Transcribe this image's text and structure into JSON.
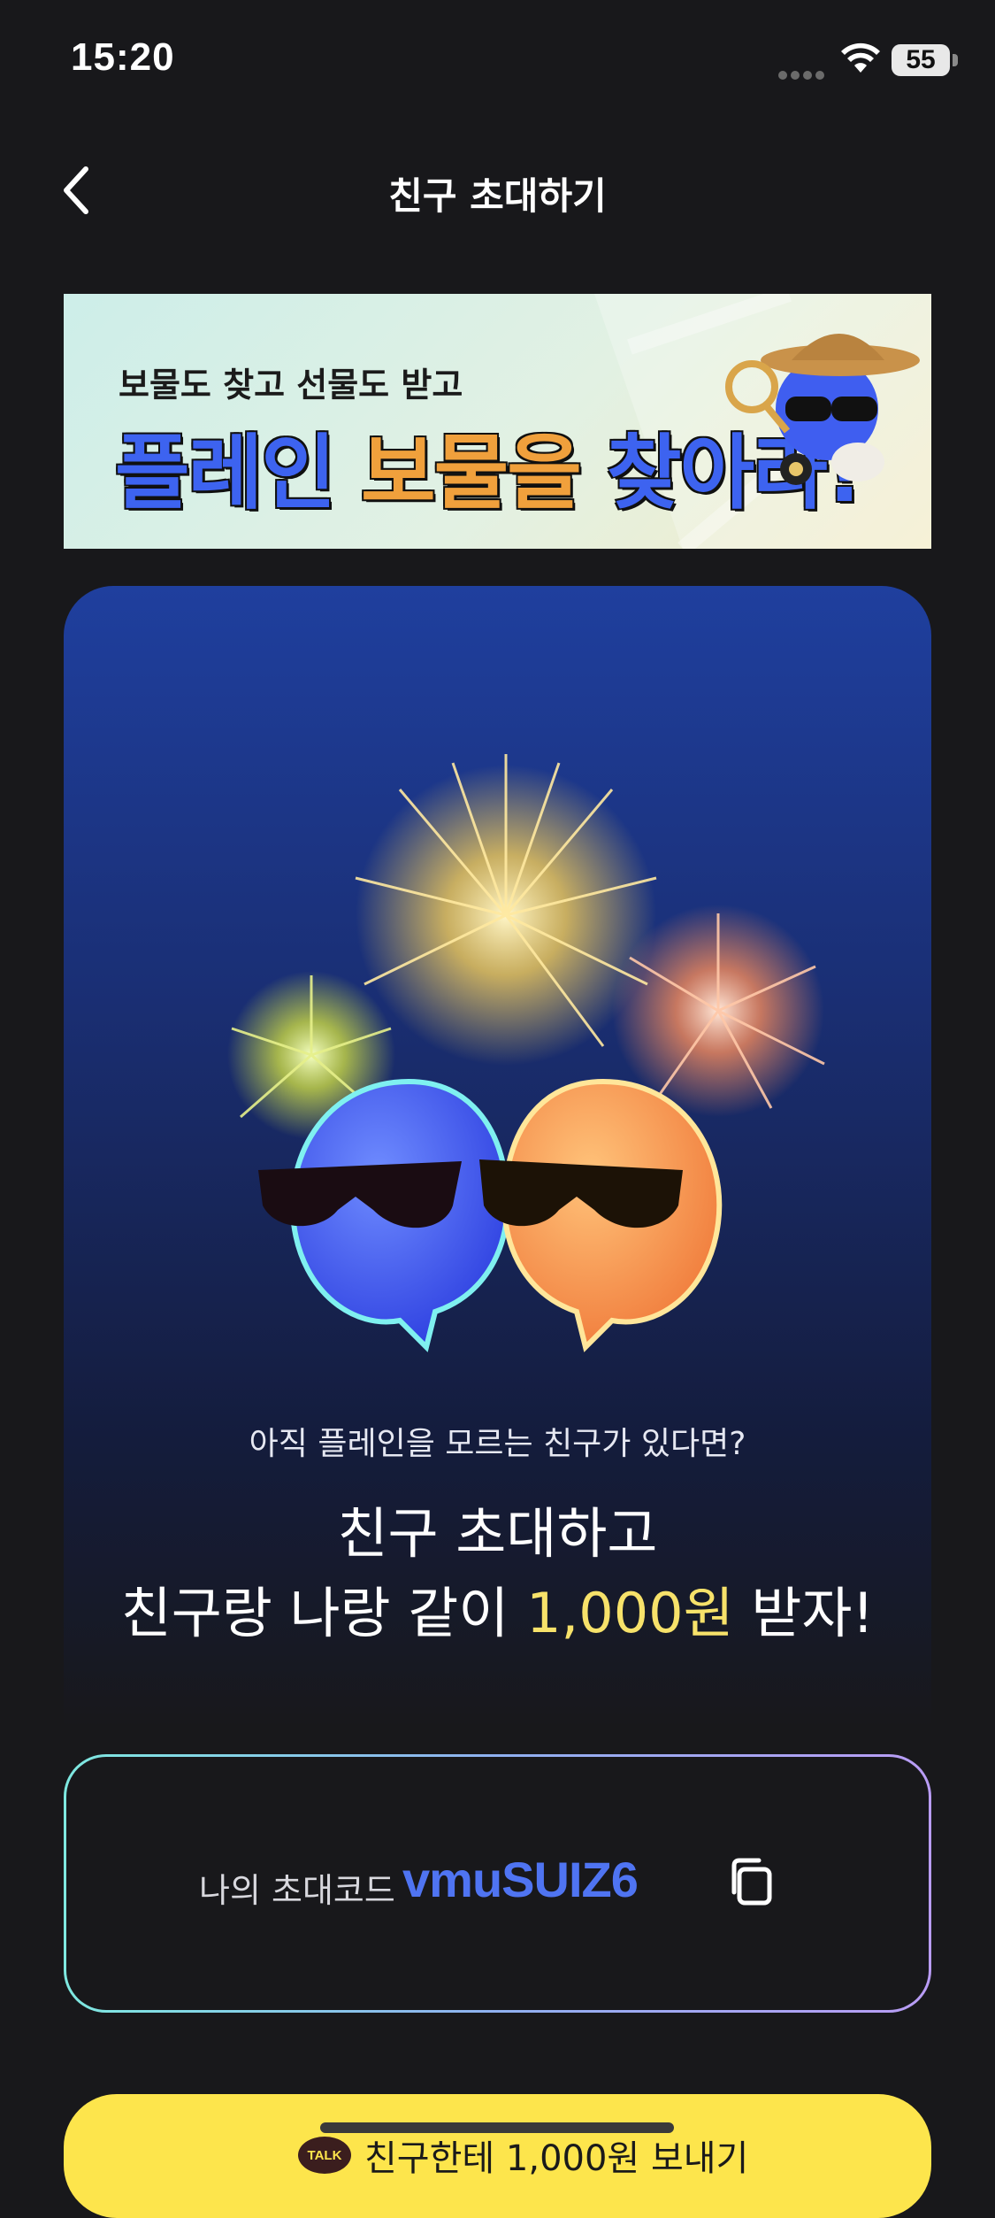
{
  "status_bar": {
    "time": "15:20",
    "battery": "55",
    "icons": [
      "signal-dots-icon",
      "wifi-icon",
      "battery-icon"
    ]
  },
  "header": {
    "title": "친구 초대하기",
    "back_icon": "chevron-left-icon"
  },
  "banner": {
    "subtitle": "보물도 찾고 선물도 받고",
    "headline_part1": "플레인",
    "headline_part2": "보물을",
    "headline_part3": "찾아라!",
    "mascot_icon": "detective-mascot-icon"
  },
  "hero": {
    "subtitle": "아직 플레인을 모르는 친구가 있다면?",
    "line1": "친구 초대하고",
    "line2_prefix": "친구랑 나랑 같이 ",
    "line2_amount": "1,000원",
    "line2_suffix": " 받자!",
    "illustration": "fireworks-mascots-illustration"
  },
  "invite": {
    "label": "나의 초대코드",
    "code": "vmuSUIZ6",
    "copy_icon": "copy-icon"
  },
  "share_button": {
    "badge": "TALK",
    "label": "친구한테 1,000원 보내기"
  },
  "colors": {
    "background": "#18181b",
    "accent_blue": "#4f74f2",
    "accent_yellow": "#fde54c",
    "highlight_amount": "#f7e26a"
  }
}
